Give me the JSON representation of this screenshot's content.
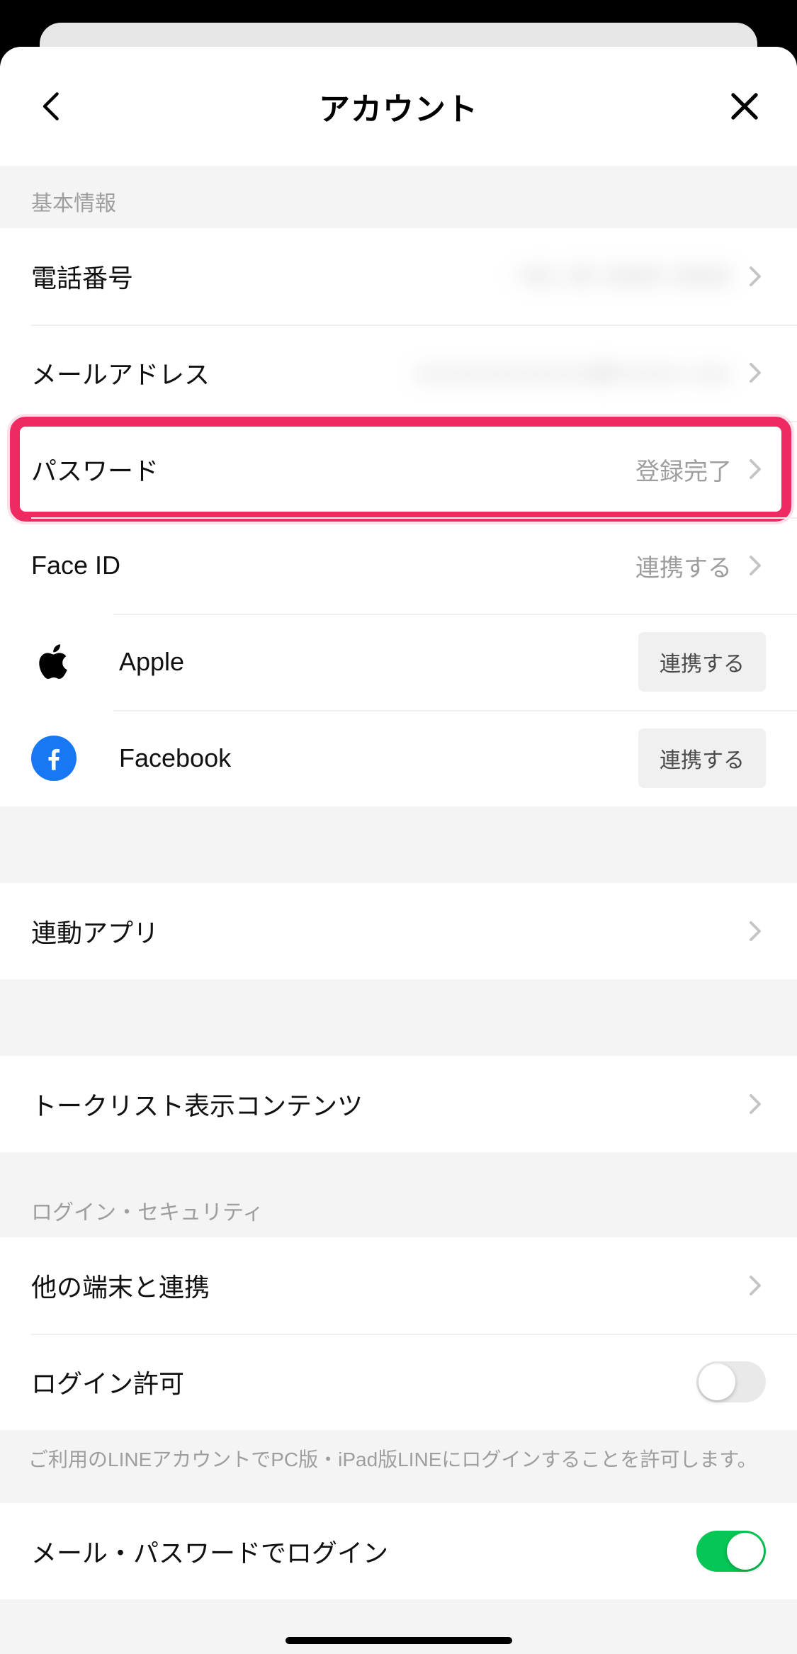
{
  "header": {
    "title": "アカウント"
  },
  "sections": {
    "basic": {
      "header": "基本情報",
      "phone": {
        "label": "電話番号",
        "value": "+81 00 0000 0000"
      },
      "email": {
        "label": "メールアドレス",
        "value": "xxxxxxxxxxxxx@xxxxx.xxx"
      },
      "password": {
        "label": "パスワード",
        "value": "登録完了"
      },
      "faceid": {
        "label": "Face ID",
        "value": "連携する"
      },
      "apple": {
        "label": "Apple",
        "button": "連携する"
      },
      "facebook": {
        "label": "Facebook",
        "button": "連携する"
      }
    },
    "linked_apps": {
      "label": "連動アプリ"
    },
    "talk_list": {
      "label": "トークリスト表示コンテンツ"
    },
    "login_security": {
      "header": "ログイン・セキュリティ",
      "other_devices": {
        "label": "他の端末と連携"
      },
      "allow_login": {
        "label": "ログイン許可",
        "on": false
      },
      "allow_login_note": "ご利用のLINEアカウントでPC版・iPad版LINEにログインすることを許可します。",
      "email_pw_login": {
        "label": "メール・パスワードでログイン",
        "on": true
      }
    }
  },
  "colors": {
    "accent": "#06c755",
    "highlight": "#ee2a63",
    "fb": "#1877f2"
  }
}
